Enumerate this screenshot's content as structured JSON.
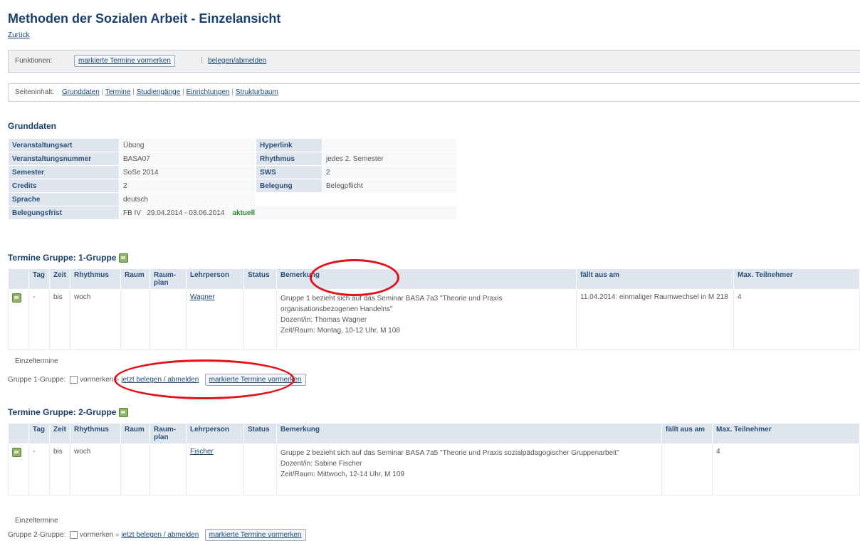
{
  "page": {
    "title": "Methoden der Sozialen Arbeit - Einzelansicht",
    "back_link": "Zurück"
  },
  "functions_bar": {
    "label": "Funktionen:",
    "mark_button": "markierte Termine vormerken",
    "enroll_link": "belegen/abmelden"
  },
  "content_bar": {
    "label": "Seiteninhalt:",
    "links": [
      "Grunddaten",
      "Termine",
      "Studiengänge",
      "Einrichtungen",
      "Strukturbaum"
    ]
  },
  "basic_data": {
    "heading": "Grunddaten",
    "rows": [
      {
        "k1": "Veranstaltungsart",
        "v1": "Übung",
        "k2": "Hyperlink",
        "v2": ""
      },
      {
        "k1": "Veranstaltungsnummer",
        "v1": "BASA07",
        "k2": "Rhythmus",
        "v2": "jedes 2. Semester"
      },
      {
        "k1": "Semester",
        "v1": "SoSe 2014",
        "k2": "SWS",
        "v2": "2"
      },
      {
        "k1": "Credits",
        "v1": "2",
        "k2": "Belegung",
        "v2": "Belegpflicht"
      },
      {
        "k1": "Sprache",
        "v1": "deutsch"
      }
    ],
    "deadline": {
      "label": "Belegungsfrist",
      "fb": "FB IV",
      "range": "29.04.2014 - 03.06.2014",
      "status": "aktuell",
      "status_color": "#2a8a2a"
    }
  },
  "group1": {
    "heading": "Termine Gruppe: 1-Gruppe",
    "columns": [
      "Tag",
      "Zeit",
      "Rhythmus",
      "Raum",
      "Raum-plan",
      "Lehrperson",
      "Status",
      "Bemerkung",
      "fällt aus am",
      "Max. Teilnehmer"
    ],
    "row": {
      "tag": "-",
      "zeit": "bis",
      "rhythmus": "woch",
      "lehrperson": "Wagner",
      "note1": "Gruppe 1 bezieht sich auf das Seminar BASA 7a3 \"Theorie und Praxis organisationsbezogenen Handelns\"",
      "note2": "Dozent/in: Thomas Wagner",
      "note3": "Zeit/Raum: Montag, 10-12 Uhr, M 108",
      "cancelled": "11.04.2014: einmaliger Raumwechsel in M 218",
      "max": "4"
    },
    "single_dates": "Einzeltermine",
    "action": {
      "label": "Gruppe 1-Gruppe:",
      "vormerken": "vormerken",
      "enroll": "jetzt belegen / abmelden",
      "button": "markierte Termine vormerken"
    }
  },
  "group2": {
    "heading": "Termine Gruppe: 2-Gruppe",
    "columns": [
      "Tag",
      "Zeit",
      "Rhythmus",
      "Raum",
      "Raum-plan",
      "Lehrperson",
      "Status",
      "Bemerkung",
      "fällt aus am",
      "Max. Teilnehmer"
    ],
    "row": {
      "tag": "-",
      "zeit": "bis",
      "rhythmus": "woch",
      "lehrperson": "Fischer",
      "note1": "Gruppe 2 bezieht sich auf das Seminar BASA 7a5 \"Theorie und Praxis sozialpädagogischer Gruppenarbeit\"",
      "note2": "Dozent/in: Sabine Fischer",
      "note3": "Zeit/Raum: Mittwoch, 12-14 Uhr, M 109",
      "cancelled": "",
      "max": "4"
    },
    "single_dates": "Einzeltermine",
    "action": {
      "label": "Gruppe 2-Gruppe:",
      "vormerken": "vormerken",
      "enroll": "jetzt belegen / abmelden",
      "button": "markierte Termine vormerken"
    }
  },
  "annotation_color": "#e3101a"
}
